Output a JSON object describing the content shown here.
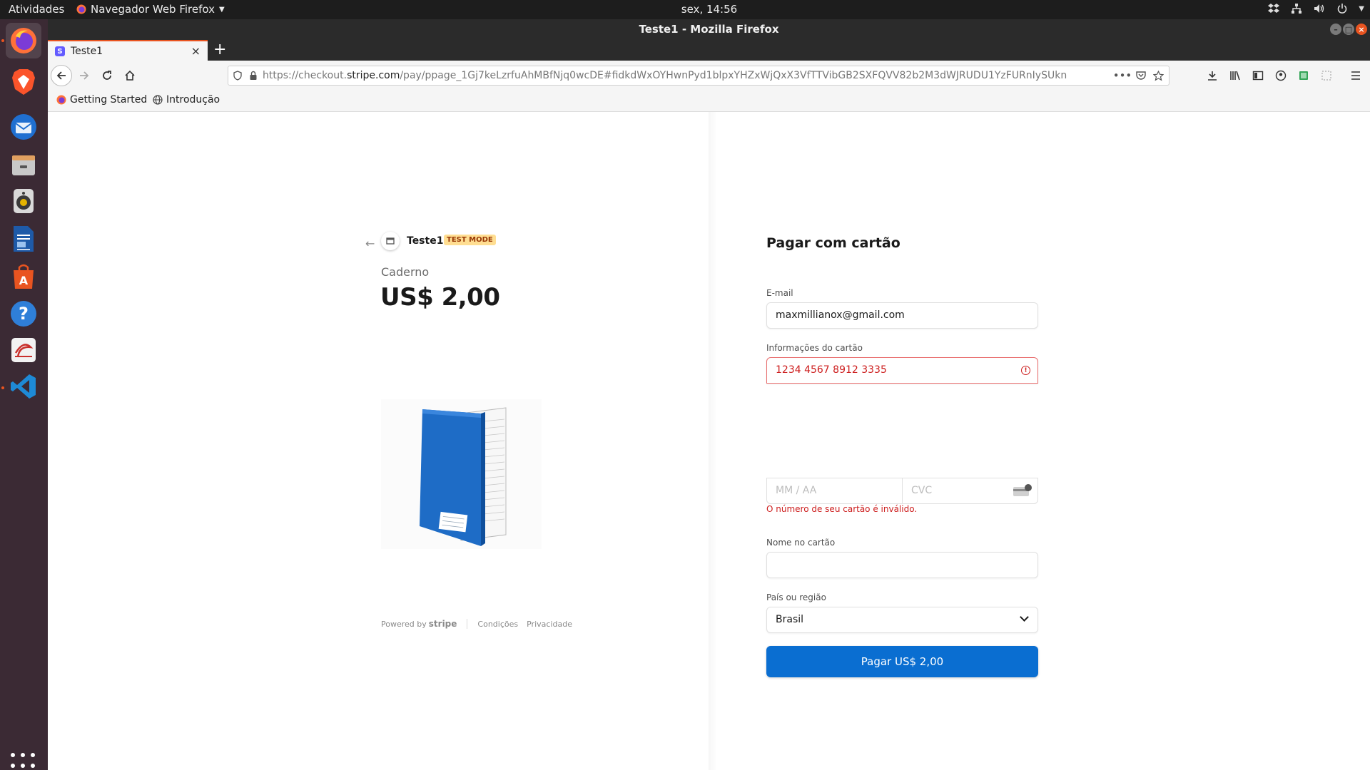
{
  "topbar": {
    "activities": "Atividades",
    "app_menu": "Navegador Web Firefox",
    "clock": "sex, 14:56"
  },
  "window": {
    "title": "Teste1 - Mozilla Firefox"
  },
  "tabs": [
    {
      "label": "Teste1"
    }
  ],
  "navbar": {
    "url_prefix": "https://checkout.",
    "url_domain": "stripe.com",
    "url_rest": "/pay/ppage_1Gj7keLzrfuAhMBfNjq0wcDE#fidkdWxOYHwnPyd1blpxYHZxWjQxX3VfTTVibGB2SXFQVV82b2M3dWJRUDU1YzFURnIySUkn"
  },
  "bookmarks": [
    {
      "label": "Getting Started"
    },
    {
      "label": "Introdução"
    }
  ],
  "product": {
    "store_name": "Teste1",
    "badge": "TEST MODE",
    "name": "Caderno",
    "price": "US$ 2,00"
  },
  "footer": {
    "powered_by": "Powered by",
    "brand": "stripe",
    "terms": "Condições",
    "privacy": "Privacidade"
  },
  "form": {
    "title": "Pagar com cartão",
    "email_label": "E-mail",
    "email_value": "maxmillianox@gmail.com",
    "card_label": "Informações do cartão",
    "card_number": "1234 4567 8912 3335",
    "expiry_placeholder": "MM / AA",
    "cvc_placeholder": "CVC",
    "card_error": "O número de seu cartão é inválido.",
    "name_label": "Nome no cartão",
    "name_value": "",
    "country_label": "País ou região",
    "country_value": "Brasil",
    "pay_button": "Pagar US$ 2,00"
  },
  "colors": {
    "accent_orange": "#e95420",
    "pay_button": "#0a6ed1",
    "error": "#cd1e1e",
    "badge_bg": "#ffde92"
  },
  "icons": {
    "dock": [
      "firefox-icon",
      "brave-icon",
      "thunderbird-icon",
      "files-icon",
      "rhythmbox-icon",
      "writer-icon",
      "software-icon",
      "help-icon",
      "evince-icon",
      "vscode-icon"
    ]
  }
}
